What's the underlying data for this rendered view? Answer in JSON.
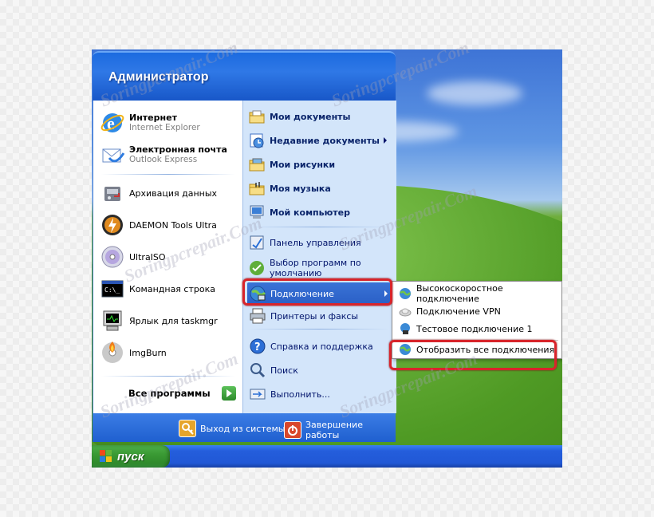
{
  "start_menu": {
    "user_name": "Администратор",
    "pinned": [
      {
        "title": "Интернет",
        "subtitle": "Internet Explorer",
        "icon": "internet-explorer-icon"
      },
      {
        "title": "Электронная почта",
        "subtitle": "Outlook Express",
        "icon": "outlook-express-icon"
      }
    ],
    "recent": [
      {
        "label": "Архивация данных",
        "icon": "backup-icon"
      },
      {
        "label": "DAEMON Tools Ultra",
        "icon": "daemon-tools-icon"
      },
      {
        "label": "UltraISO",
        "icon": "ultraiso-icon"
      },
      {
        "label": "Командная строка",
        "icon": "command-prompt-icon"
      },
      {
        "label": "Ярлык для taskmgr",
        "icon": "task-manager-icon"
      },
      {
        "label": "ImgBurn",
        "icon": "imgburn-icon"
      }
    ],
    "all_programs": "Все программы",
    "right": {
      "my_documents": "Мои документы",
      "recent_documents": "Недавние документы",
      "my_pictures": "Мои рисунки",
      "my_music": "Моя музыка",
      "my_computer": "Мой компьютер",
      "control_panel": "Панель управления",
      "default_programs_line1": "Выбор программ по",
      "default_programs_line2": "умолчанию",
      "connect": "Подключение",
      "printers": "Принтеры и факсы",
      "help": "Справка и поддержка",
      "search": "Поиск",
      "run": "Выполнить..."
    },
    "footer": {
      "logoff": "Выход из системы",
      "shutdown": "Завершение работы"
    }
  },
  "connect_submenu": [
    {
      "label": "Высокоскоростное подключение",
      "icon": "globe-network-icon"
    },
    {
      "label": "Подключение VPN",
      "icon": "vpn-icon"
    },
    {
      "label": "Тестовое подключение 1",
      "icon": "dialup-icon"
    }
  ],
  "show_all_connections": "Отобразить все подключения",
  "taskbar": {
    "start_label": "пуск"
  },
  "watermark": "Soringpcrepair.Com",
  "colors": {
    "highlight_border": "#d8242b",
    "selection": "#2f67cf"
  }
}
